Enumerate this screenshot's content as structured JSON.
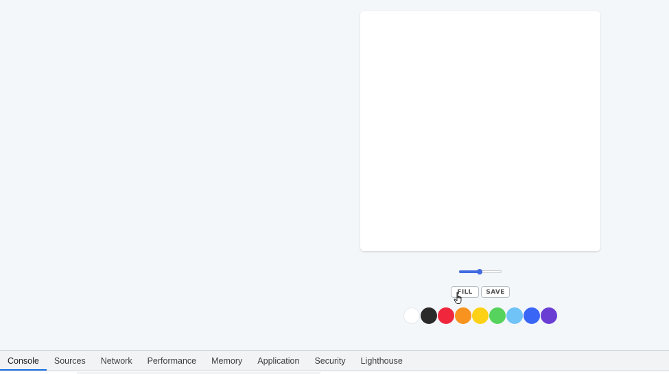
{
  "canvas": {
    "background": "#ffffff"
  },
  "brush": {
    "size_fraction": 0.48,
    "accent_color": "#4169e1"
  },
  "buttons": {
    "fill_label": "FILL",
    "save_label": "SAVE"
  },
  "palette": {
    "colors": [
      "#ffffff",
      "#2a2a2a",
      "#f0263c",
      "#f7931e",
      "#fcd116",
      "#56d35c",
      "#6fc3f7",
      "#3a66f5",
      "#6a3ed3"
    ]
  },
  "devtools": {
    "tabs": [
      {
        "label": "Console",
        "active": true
      },
      {
        "label": "Sources",
        "active": false
      },
      {
        "label": "Network",
        "active": false
      },
      {
        "label": "Performance",
        "active": false
      },
      {
        "label": "Memory",
        "active": false
      },
      {
        "label": "Application",
        "active": false
      },
      {
        "label": "Security",
        "active": false
      },
      {
        "label": "Lighthouse",
        "active": false
      }
    ],
    "accent": "#1a73e8"
  }
}
